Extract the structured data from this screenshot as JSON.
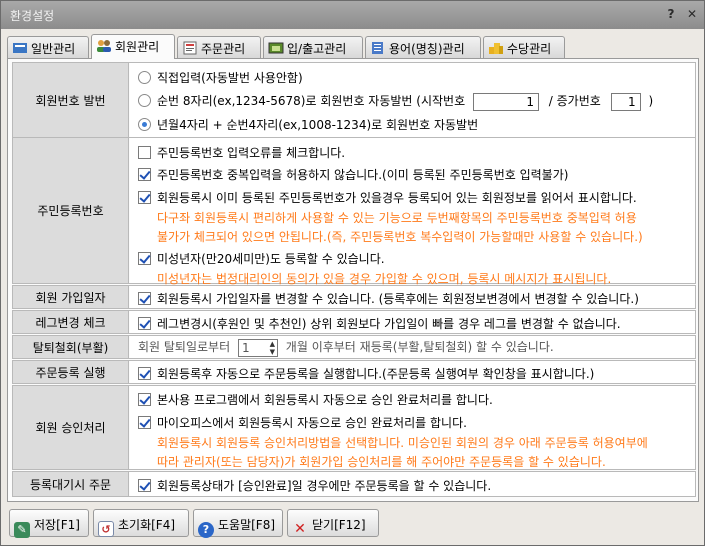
{
  "window": {
    "title": "환경설정",
    "help": "?",
    "close": "✕"
  },
  "tabs": [
    {
      "label": "일반관리"
    },
    {
      "label": "회원관리"
    },
    {
      "label": "주문관리"
    },
    {
      "label": "입/출고관리"
    },
    {
      "label": "용어(명칭)관리"
    },
    {
      "label": "수당관리"
    }
  ],
  "member_no": {
    "label": "회원번호 발번",
    "opt1": "직접입력(자동발번 사용안함)",
    "opt2_prefix": "순번 8자리(ex,1234-5678)로 회원번호 자동발번 (시작번호",
    "opt2_start": "1",
    "opt2_mid": "/ 증가번호",
    "opt2_inc": "1",
    "opt2_suffix": ")",
    "opt3": "년월4자리 + 순번4자리(ex,1008-1234)로 회원번호 자동발번"
  },
  "ssn": {
    "label": "주민등록번호",
    "c1": "주민등록번호 입력오류를 체크합니다.",
    "c2": "주민등록번호 중복입력을 허용하지 않습니다.(이미 등록된 주민등록번호 입력불가)",
    "c3": "회원등록시 이미 등록된 주민등록번호가 있을경우 등록되어 있는 회원정보를 읽어서 표시합니다.",
    "n3a": "다구좌 회원등록시 편리하게 사용할 수 있는 기능으로 두번째항목의 주민등록번호 중복입력 허용",
    "n3b": "불가가 체크되어 있으면 안됩니다.(즉, 주민등록번호 복수입력이 가능할때만 사용할 수 있습니다.)",
    "c4": "미성년자(만20세미만)도 등록할 수 있습니다.",
    "n4": "미성년자는 법정대리인의 동의가 있을 경우 가입할 수 있으며, 등록시 메시지가 표시됩니다."
  },
  "join_date": {
    "label": "회원 가입일자",
    "c1": "회원등록시 가입일자를 변경할 수 있습니다. (등록후에는 회원정보변경에서 변경할 수 있습니다.)"
  },
  "leg_change": {
    "label": "레그변경 체크",
    "c1": "레그변경시(후원인 및 추천인) 상위 회원보다 가입일이 빠를 경우 레그를 변경할 수 없습니다."
  },
  "withdraw": {
    "label": "탈퇴철회(부활)",
    "prefix": "회원 탈퇴일로부터",
    "months": "1",
    "suffix": "개월 이후부터  재등록(부활,탈퇴철회) 할 수 있습니다."
  },
  "order_reg": {
    "label": "주문등록 실행",
    "c1": "회원등록후 자동으로 주문등록을 실행합니다.(주문등록 실행여부 확인창을 표시합니다.)"
  },
  "approval": {
    "label": "회원 승인처리",
    "c1": "본사용 프로그램에서 회원등록시 자동으로 승인 완료처리를 합니다.",
    "c2": "마이오피스에서 회원등록시 자동으로 승인 완료처리를 합니다.",
    "n2a": "회원등록시 회원등록 승인처리방법을 선택합니다. 미승인된 회원의 경우 아래 주문등록 허용여부에",
    "n2b": "따라 관리자(또는 담당자)가 회원가입 승인처리를 해 주어야만 주문등록을 할 수 있습니다."
  },
  "waiting": {
    "label": "등록대기시 주문",
    "c1": "회원등록상태가 [승인완료]일 경우에만 주문등록을 할 수 있습니다."
  },
  "buttons": {
    "save": "저장[F1]",
    "reset": "초기화[F4]",
    "help": "도움말[F8]",
    "close": "닫기[F12]"
  }
}
